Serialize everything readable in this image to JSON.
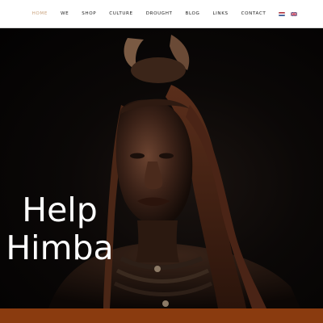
{
  "nav": {
    "items": [
      {
        "label": "HOME",
        "active": true
      },
      {
        "label": "WE",
        "active": false
      },
      {
        "label": "SHOP",
        "active": false
      },
      {
        "label": "CULTURE",
        "active": false
      },
      {
        "label": "DROUGHT",
        "active": false
      },
      {
        "label": "BLOG",
        "active": false
      },
      {
        "label": "LINKS",
        "active": false
      },
      {
        "label": "CONTACT",
        "active": false
      }
    ],
    "flags": [
      "dutch-flag-icon",
      "uk-flag-icon"
    ]
  },
  "hero": {
    "title_line1": "Help",
    "title_line2": "Himba"
  },
  "colors": {
    "active_nav": "#c9a27c",
    "footer_bar": "#8a3b0f",
    "hero_text": "#ffffff"
  }
}
